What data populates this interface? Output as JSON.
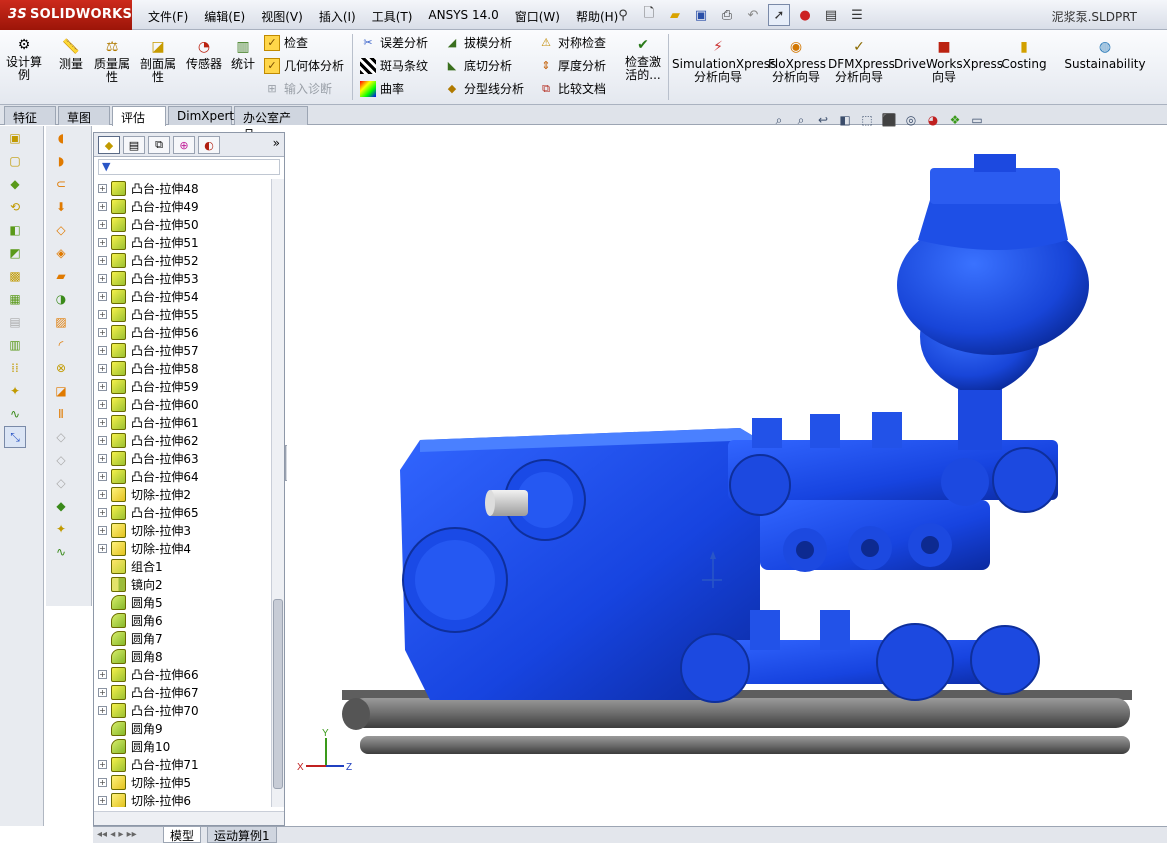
{
  "app": {
    "logo_prefix": "3S",
    "logo_text": "SOLIDWORKS",
    "file_name": "泥浆泵.SLDPRT"
  },
  "menu": [
    "文件(F)",
    "编辑(E)",
    "视图(V)",
    "插入(I)",
    "工具(T)",
    "ANSYS 14.0",
    "窗口(W)",
    "帮助(H)"
  ],
  "ribbon": {
    "design_study": "设计算例",
    "measure": "测量",
    "mass_props": "质量属性",
    "section_props": "剖面属性",
    "sensor": "传感器",
    "statistics": "统计",
    "check": "检查",
    "geometry_analysis": "几何体分析",
    "import_diagnostics": "输入诊断",
    "deviation_analysis": "误差分析",
    "zebra_stripes": "斑马条纹",
    "curvature": "曲率",
    "draft_analysis": "拔模分析",
    "undercut_analysis": "底切分析",
    "parting_line_analysis": "分型线分析",
    "symmetry_check": "对称检查",
    "thickness_analysis": "厚度分析",
    "compare_docs": "比较文档",
    "check_active": "检查激活的...",
    "simxpress": "SimulationXpress分析向导",
    "floxpress": "FloXpress分析向导",
    "dfmxpress": "DFMXpress分析向导",
    "driveworks": "DriveWorksXpress向导",
    "costing": "Costing",
    "sustainability": "Sustainability"
  },
  "tabs": [
    "特征",
    "草图",
    "评估",
    "DimXpert",
    "办公室产品"
  ],
  "active_tab": "评估",
  "tree": [
    {
      "label": "凸台-拉伸48",
      "type": "boss",
      "expand": true
    },
    {
      "label": "凸台-拉伸49",
      "type": "boss",
      "expand": true
    },
    {
      "label": "凸台-拉伸50",
      "type": "boss",
      "expand": true
    },
    {
      "label": "凸台-拉伸51",
      "type": "boss",
      "expand": true
    },
    {
      "label": "凸台-拉伸52",
      "type": "boss",
      "expand": true
    },
    {
      "label": "凸台-拉伸53",
      "type": "boss",
      "expand": true
    },
    {
      "label": "凸台-拉伸54",
      "type": "boss",
      "expand": true
    },
    {
      "label": "凸台-拉伸55",
      "type": "boss",
      "expand": true
    },
    {
      "label": "凸台-拉伸56",
      "type": "boss",
      "expand": true
    },
    {
      "label": "凸台-拉伸57",
      "type": "boss",
      "expand": true
    },
    {
      "label": "凸台-拉伸58",
      "type": "boss",
      "expand": true
    },
    {
      "label": "凸台-拉伸59",
      "type": "boss",
      "expand": true
    },
    {
      "label": "凸台-拉伸60",
      "type": "boss",
      "expand": true
    },
    {
      "label": "凸台-拉伸61",
      "type": "boss",
      "expand": true
    },
    {
      "label": "凸台-拉伸62",
      "type": "boss",
      "expand": true
    },
    {
      "label": "凸台-拉伸63",
      "type": "boss",
      "expand": true
    },
    {
      "label": "凸台-拉伸64",
      "type": "boss",
      "expand": true
    },
    {
      "label": "切除-拉伸2",
      "type": "cut",
      "expand": true
    },
    {
      "label": "凸台-拉伸65",
      "type": "boss",
      "expand": true
    },
    {
      "label": "切除-拉伸3",
      "type": "cut",
      "expand": true
    },
    {
      "label": "切除-拉伸4",
      "type": "cut",
      "expand": true
    },
    {
      "label": "组合1",
      "type": "combine",
      "expand": false
    },
    {
      "label": "镜向2",
      "type": "mirror",
      "expand": false
    },
    {
      "label": "圆角5",
      "type": "fillet",
      "expand": false
    },
    {
      "label": "圆角6",
      "type": "fillet",
      "expand": false
    },
    {
      "label": "圆角7",
      "type": "fillet",
      "expand": false
    },
    {
      "label": "圆角8",
      "type": "fillet",
      "expand": false
    },
    {
      "label": "凸台-拉伸66",
      "type": "boss",
      "expand": true
    },
    {
      "label": "凸台-拉伸67",
      "type": "boss",
      "expand": true
    },
    {
      "label": "凸台-拉伸70",
      "type": "boss",
      "expand": true
    },
    {
      "label": "圆角9",
      "type": "fillet",
      "expand": false
    },
    {
      "label": "圆角10",
      "type": "fillet",
      "expand": false
    },
    {
      "label": "凸台-拉伸71",
      "type": "boss",
      "expand": true
    },
    {
      "label": "切除-拉伸5",
      "type": "cut",
      "expand": true
    },
    {
      "label": "切除-拉伸6",
      "type": "cut",
      "expand": true
    }
  ],
  "bottom_tabs": [
    "模型",
    "运动算例1"
  ],
  "active_bottom_tab": "模型",
  "triad": {
    "x": "X",
    "y": "Y",
    "z": "Z"
  },
  "colors": {
    "model_blue": "#1a4fe0",
    "brand_red": "#b01e10",
    "base_gray": "#7d7d7d"
  }
}
